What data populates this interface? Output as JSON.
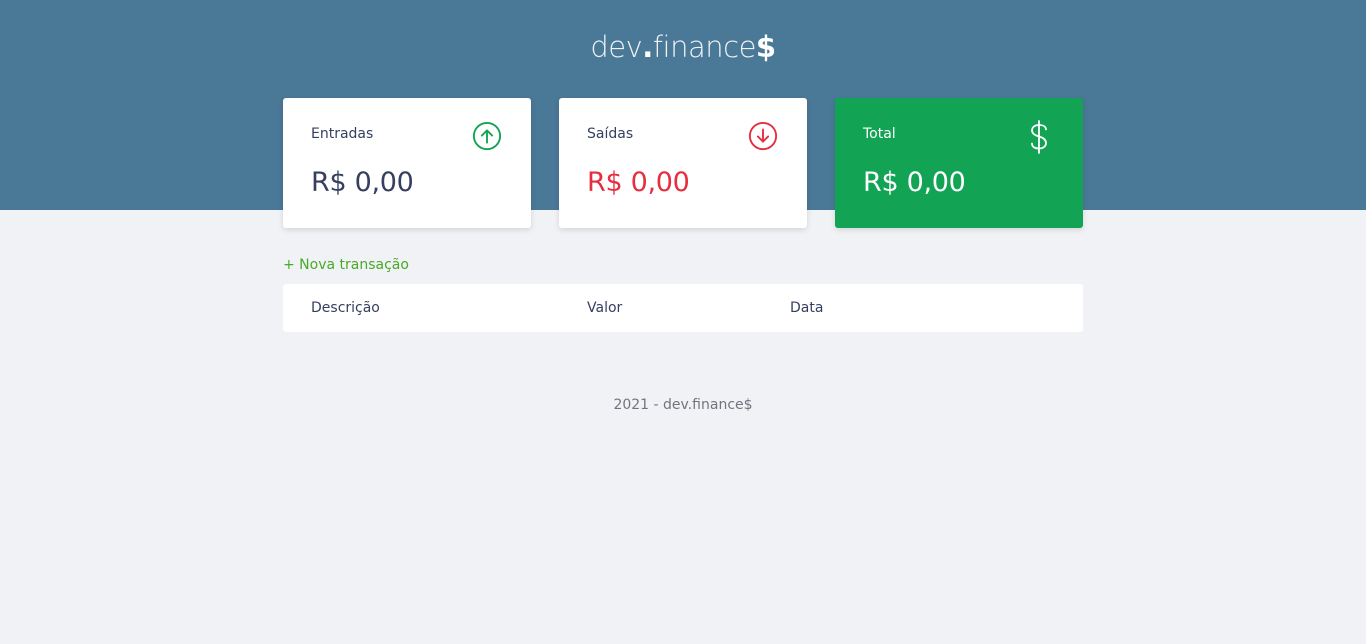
{
  "header": {
    "logo_prefix": "dev",
    "logo_dot": ".",
    "logo_mid": "finance",
    "logo_dollar": "$"
  },
  "cards": [
    {
      "label": "Entradas",
      "amount": "R$ 0,00",
      "icon": "arrow-up-circle-icon",
      "color": "#12a454"
    },
    {
      "label": "Saídas",
      "amount": "R$ 0,00",
      "icon": "arrow-down-circle-icon",
      "color": "#e52e40"
    },
    {
      "label": "Total",
      "amount": "R$ 0,00",
      "icon": "dollar-sign-icon",
      "color": "#12a454"
    }
  ],
  "actions": {
    "new_transaction": "+ Nova transação"
  },
  "table": {
    "columns": [
      "Descrição",
      "Valor",
      "Data"
    ],
    "rows": []
  },
  "footer": {
    "text": "2021 - dev.finance$"
  },
  "colors": {
    "header_bg": "#4a7897",
    "page_bg": "#f0f2f5",
    "green": "#12a454",
    "red": "#e52e40",
    "link_green": "#49aa26",
    "text": "#363f5f"
  }
}
